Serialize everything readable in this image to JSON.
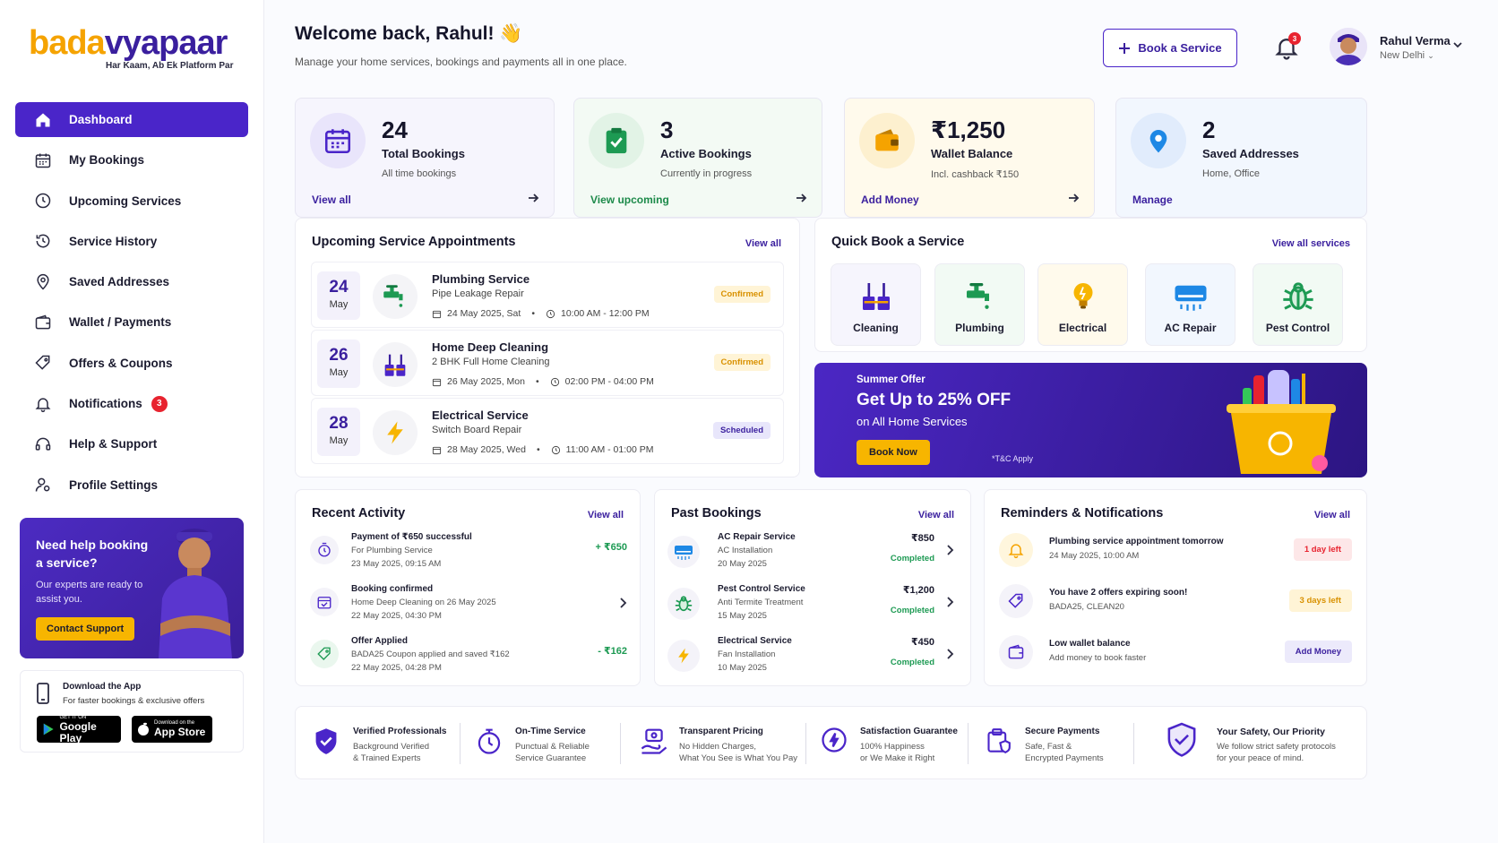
{
  "brand": {
    "name_part1": "bada",
    "name_part2": "vyapaar",
    "tagline": "Har Kaam, Ab Ek Platform Par"
  },
  "sidebar": {
    "items": [
      {
        "label": "Dashboard"
      },
      {
        "label": "My Bookings"
      },
      {
        "label": "Upcoming Services"
      },
      {
        "label": "Service History"
      },
      {
        "label": "Saved Addresses"
      },
      {
        "label": "Wallet / Payments"
      },
      {
        "label": "Offers & Coupons"
      },
      {
        "label": "Notifications",
        "badge": "3"
      },
      {
        "label": "Help & Support"
      },
      {
        "label": "Profile Settings"
      }
    ],
    "help": {
      "title": "Need help booking a service?",
      "text": "Our experts are ready to assist you.",
      "button": "Contact Support"
    },
    "app": {
      "title": "Download the App",
      "subtitle": "For faster bookings & exclusive offers",
      "google_small": "GET IT ON",
      "google_big": "Google Play",
      "apple_small": "Download on the",
      "apple_big": "App Store"
    }
  },
  "header": {
    "title": "Welcome back, Rahul! 👋",
    "subtitle": "Manage your home services, bookings and payments all in one place.",
    "book_button": "Book a Service",
    "notif_count": "3",
    "user_name": "Rahul Verma",
    "user_location": "New Delhi"
  },
  "stats": [
    {
      "value": "24",
      "label": "Total Bookings",
      "sub": "All time bookings",
      "link": "View all"
    },
    {
      "value": "3",
      "label": "Active Bookings",
      "sub": "Currently in progress",
      "link": "View upcoming"
    },
    {
      "value": "₹1,250",
      "label": "Wallet Balance",
      "sub": "Incl. cashback ₹150",
      "link": "Add Money"
    },
    {
      "value": "2",
      "label": "Saved Addresses",
      "sub": "Home, Office",
      "link": "Manage"
    }
  ],
  "upcoming": {
    "title": "Upcoming Service Appointments",
    "link": "View all",
    "items": [
      {
        "day": "24",
        "month": "May",
        "title": "Plumbing Service",
        "sub": "Pipe Leakage Repair",
        "date": "24 May 2025, Sat",
        "time": "10:00 AM - 12:00 PM",
        "status": "Confirmed"
      },
      {
        "day": "26",
        "month": "May",
        "title": "Home Deep Cleaning",
        "sub": "2 BHK Full Home Cleaning",
        "date": "26 May 2025, Mon",
        "time": "02:00 PM - 04:00 PM",
        "status": "Confirmed"
      },
      {
        "day": "28",
        "month": "May",
        "title": "Electrical Service",
        "sub": "Switch Board Repair",
        "date": "28 May 2025, Wed",
        "time": "11:00 AM - 01:00 PM",
        "status": "Scheduled"
      }
    ]
  },
  "quickbook": {
    "title": "Quick Book a Service",
    "link": "View all services",
    "items": [
      {
        "label": "Cleaning"
      },
      {
        "label": "Plumbing"
      },
      {
        "label": "Electrical"
      },
      {
        "label": "AC Repair"
      },
      {
        "label": "Pest Control"
      }
    ]
  },
  "promo": {
    "eyebrow": "Summer Offer",
    "headline": "Get Up to 25% OFF",
    "sub": "on All Home Services",
    "button": "Book Now",
    "terms": "*T&C Apply"
  },
  "activity": {
    "title": "Recent Activity",
    "link": "View all",
    "items": [
      {
        "title": "Payment of ₹650 successful",
        "sub": "For Plumbing Service",
        "date": "23 May 2025, 09:15 AM",
        "amount": "+ ₹650"
      },
      {
        "title": "Booking confirmed",
        "sub": "Home Deep Cleaning on 26 May 2025",
        "date": "22 May 2025, 04:30 PM",
        "amount": ""
      },
      {
        "title": "Offer Applied",
        "sub": "BADA25 Coupon applied and saved ₹162",
        "date": "22 May 2025, 04:28 PM",
        "amount": "- ₹162"
      }
    ]
  },
  "past": {
    "title": "Past Bookings",
    "link": "View all",
    "items": [
      {
        "title": "AC Repair Service",
        "sub": "AC Installation",
        "date": "20 May 2025",
        "amount": "₹850",
        "status": "Completed"
      },
      {
        "title": "Pest Control Service",
        "sub": "Anti Termite Treatment",
        "date": "15 May 2025",
        "amount": "₹1,200",
        "status": "Completed"
      },
      {
        "title": "Electrical Service",
        "sub": "Fan Installation",
        "date": "10 May 2025",
        "amount": "₹450",
        "status": "Completed"
      }
    ]
  },
  "reminders": {
    "title": "Reminders & Notifications",
    "link": "View all",
    "items": [
      {
        "title": "Plumbing service appointment tomorrow",
        "sub": "24 May 2025, 10:00 AM",
        "tag": "1 day left"
      },
      {
        "title": "You have 2 offers expiring soon!",
        "sub": "BADA25, CLEAN20",
        "tag": "3 days left"
      },
      {
        "title": "Low wallet balance",
        "sub": "Add money to book faster",
        "tag": "Add Money"
      }
    ]
  },
  "trust": [
    {
      "title": "Verified Professionals",
      "l1": "Background Verified",
      "l2": "& Trained Experts"
    },
    {
      "title": "On-Time Service",
      "l1": "Punctual & Reliable",
      "l2": "Service Guarantee"
    },
    {
      "title": "Transparent Pricing",
      "l1": "No Hidden Charges,",
      "l2": "What You See is What You Pay"
    },
    {
      "title": "Satisfaction Guarantee",
      "l1": "100% Happiness",
      "l2": "or We Make it Right"
    },
    {
      "title": "Secure Payments",
      "l1": "Safe, Fast &",
      "l2": "Encrypted Payments"
    },
    {
      "title": "Your Safety, Our Priority",
      "l1": "We follow strict safety protocols",
      "l2": "for your peace of mind."
    }
  ],
  "colors": {
    "primary": "#4a25c9",
    "accent": "#f7b500",
    "success": "#1d9a53",
    "danger": "#e8232f"
  }
}
